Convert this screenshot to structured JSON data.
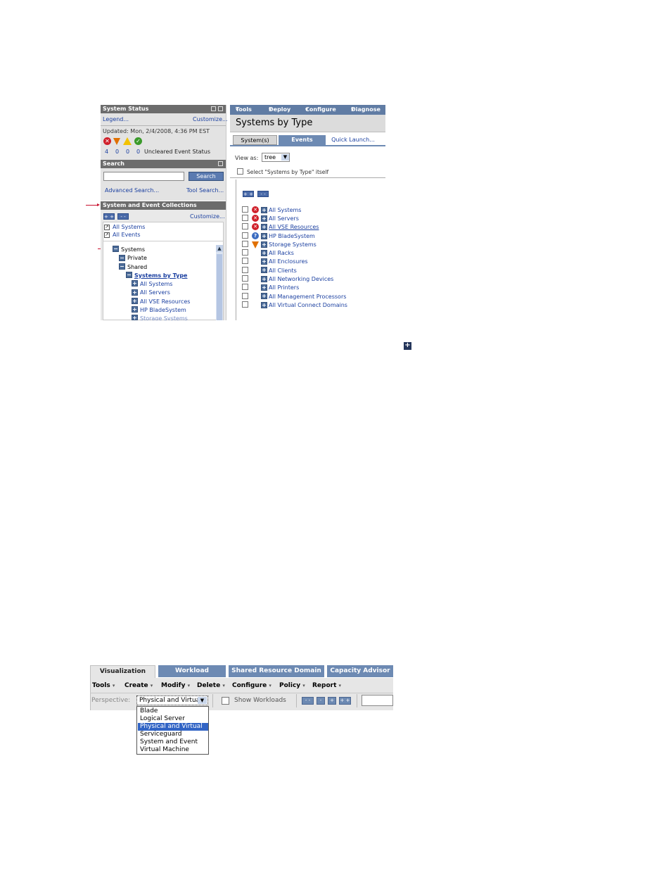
{
  "left": {
    "status": {
      "title": "System Status",
      "legend": "Legend...",
      "customize": "Customize...",
      "updated": "Updated: Mon, 2/4/2008, 4:36 PM EST",
      "counts": [
        "4",
        "0",
        "0",
        "0"
      ],
      "uncleared": "Uncleared Event Status"
    },
    "search": {
      "title": "Search",
      "button": "Search",
      "advanced": "Advanced Search...",
      "tool": "Tool Search..."
    },
    "collections": {
      "title": "System and Event Collections",
      "expand_all": "+ +",
      "collapse_all": "- -",
      "customize": "Customize...",
      "links": [
        "All Systems",
        "All Events"
      ],
      "tree": {
        "systems": "Systems",
        "private": "Private",
        "shared": "Shared",
        "systems_by_type": "Systems by Type",
        "children": [
          "All Systems",
          "All Servers",
          "All VSE Resources",
          "HP BladeSystem",
          "Storage Systems"
        ]
      }
    }
  },
  "right": {
    "menu": [
      "Tools",
      "Deploy",
      "Configure",
      "Diagnose"
    ],
    "title": "Systems by Type",
    "tabs": [
      "System(s)",
      "Events",
      "Quick Launch..."
    ],
    "view_as_label": "View as:",
    "view_as_value": "tree",
    "select_itself": "Select \"Systems by Type\" itself",
    "expand_all": "+ +",
    "collapse_all": "- -",
    "items": [
      {
        "label": "All Systems",
        "status": "critical"
      },
      {
        "label": "All Servers",
        "status": "critical"
      },
      {
        "label": "All VSE Resources",
        "status": "critical"
      },
      {
        "label": "HP BladeSystem",
        "status": "unknown"
      },
      {
        "label": "Storage Systems",
        "status": "major"
      },
      {
        "label": "All Racks",
        "status": "none"
      },
      {
        "label": "All Enclosures",
        "status": "none"
      },
      {
        "label": "All Clients",
        "status": "none"
      },
      {
        "label": "All Networking Devices",
        "status": "none"
      },
      {
        "label": "All Printers",
        "status": "none"
      },
      {
        "label": "All Management Processors",
        "status": "none"
      },
      {
        "label": "All Virtual Connect Domains",
        "status": "none"
      }
    ]
  },
  "expand_icon": "plus-icon",
  "bottom": {
    "tabs": [
      "Visualization",
      "Workload",
      "Shared Resource Domain",
      "Capacity Advisor"
    ],
    "menu": [
      "Tools",
      "Create",
      "Modify",
      "Delete",
      "Configure",
      "Policy",
      "Report"
    ],
    "perspective_label": "Perspective:",
    "perspective_value": "Physical and Virtual",
    "show_workloads": "Show Workloads",
    "zoom_buttons": [
      "- -",
      "-",
      "+",
      "+ +"
    ],
    "dropdown_options": [
      "Blade",
      "Logical Server",
      "Physical and Virtual",
      "Serviceguard",
      "System and Event",
      "Virtual Machine"
    ],
    "selected_option": "Physical and Virtual"
  },
  "colors": {
    "header_gray": "#6c6c6c",
    "menu_blue": "#607ca4",
    "tab_blue": "#6d8ab3",
    "link_blue": "#1a3fa0",
    "critical_red": "#d0202a",
    "annotation_red": "#c8102e"
  }
}
